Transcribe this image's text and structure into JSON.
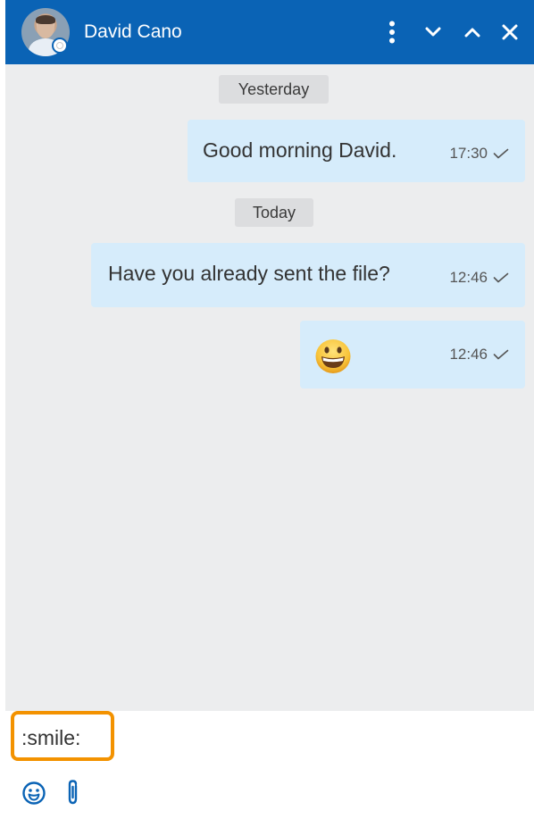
{
  "header": {
    "contact_name": "David Cano",
    "presence": "offline",
    "accent_color": "#0a63b5",
    "buttons": {
      "more": "more-vertical-icon",
      "minimize": "chevron-down-icon",
      "maximize": "chevron-up-icon",
      "close": "close-icon"
    }
  },
  "conversation": {
    "separators": {
      "yesterday": "Yesterday",
      "today": "Today"
    },
    "messages": [
      {
        "text": "Good morning David.",
        "time": "17:30",
        "status_icon": "check-icon"
      },
      {
        "text": "Have you already sent the file?",
        "time": "12:46",
        "status_icon": "check-icon"
      },
      {
        "emoji": "grinning-face-emoji",
        "time": "12:46",
        "status_icon": "check-icon"
      }
    ],
    "bubble_color": "#d6ecfb",
    "background_color": "#ecedee"
  },
  "composer": {
    "input_value": ":smile:",
    "highlight_color": "#f39200",
    "tools": [
      "emoji-picker-icon",
      "paperclip-icon"
    ]
  }
}
